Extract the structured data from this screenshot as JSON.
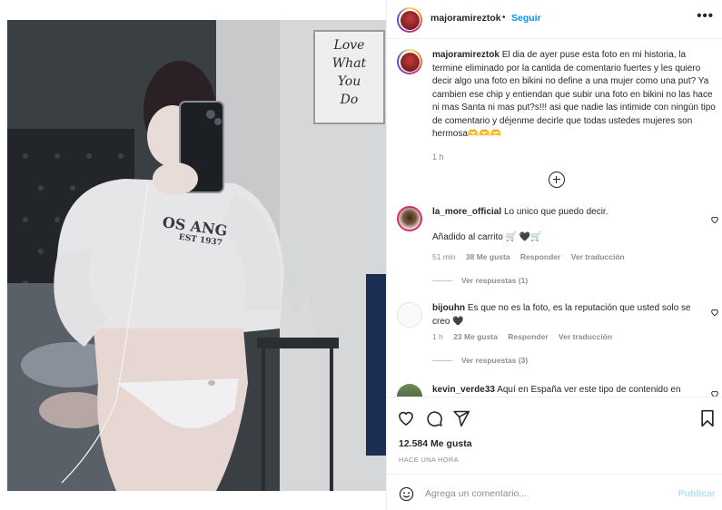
{
  "post": {
    "username": "majoramireztok",
    "separator": "•",
    "follow_label": "Seguir",
    "more_label": "•••",
    "caption_user": "majoramireztok",
    "caption_text": "El dia de ayer puse esta foto en mi historia, la termine eliminado por la cantida de comentario fuertes y les quiero decir algo una foto en bikini no define a una mujer como una put? Ya cambien ese chip y entiendan que subir una foto en bikini no las hace ni mas Santa ni mas put?s!!! asi que nadie las intimide con ningún tipo de comentario y déjenme decirle que todas ustedes mujeres son hermosa🫶🫶🫶",
    "caption_time": "1 h"
  },
  "photo": {
    "poster_lines": [
      "Love",
      "What",
      "You",
      "Do"
    ],
    "sweater_text": "OS ANG",
    "sweater_text2": "EST 1937"
  },
  "comments": [
    {
      "user": "la_more_official",
      "text": "Lo unico que puedo decir.",
      "extra": "Añadido al carrito 🛒 🖤🛒",
      "time": "51 min",
      "likes": "38 Me gusta",
      "reply": "Responder",
      "translate": "Ver traducción",
      "replies": "Ver respuestas (1)"
    },
    {
      "user": "bijouhn",
      "text": "Es que no es la foto, es la reputación que usted solo se creo 🖤",
      "time": "1 h",
      "likes": "23 Me gusta",
      "reply": "Responder",
      "translate": "Ver traducción",
      "replies": "Ver respuestas (3)"
    },
    {
      "user": "kevin_verde33",
      "text": "Aquí en España ver este tipo de contenido en"
    }
  ],
  "footer": {
    "likes": "12.584 Me gusta",
    "ago": "HACE UNA HORA",
    "comment_placeholder": "Agrega un comentario...",
    "publish_label": "Publicar"
  },
  "colors": {
    "accent": "#0095f6",
    "muted": "#8e8e8e",
    "publish_disabled": "#b2dffc"
  }
}
